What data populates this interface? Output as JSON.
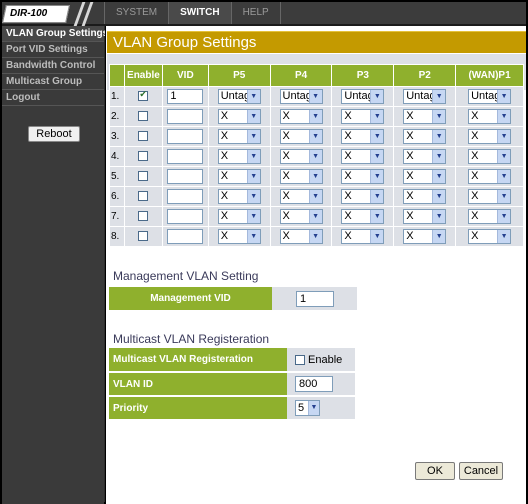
{
  "header": {
    "logo": "DIR-100",
    "tabs": [
      "SYSTEM",
      "SWITCH",
      "HELP"
    ],
    "active_tab": "SWITCH"
  },
  "sidebar": {
    "items": [
      "VLAN Group Settings",
      "Port VID Settings",
      "Bandwidth Control",
      "Multicast Group",
      "Logout"
    ],
    "reboot_label": "Reboot"
  },
  "main": {
    "title": "VLAN Group Settings",
    "columns": [
      "",
      "Enable",
      "VID",
      "P5",
      "P4",
      "P3",
      "P2",
      "(WAN)P1"
    ],
    "rows": [
      {
        "num": "1.",
        "enabled": true,
        "vid": "1",
        "ports": [
          "Untag",
          "Untag",
          "Untag",
          "Untag",
          "Untag"
        ]
      },
      {
        "num": "2.",
        "enabled": false,
        "vid": "",
        "ports": [
          "X",
          "X",
          "X",
          "X",
          "X"
        ]
      },
      {
        "num": "3.",
        "enabled": false,
        "vid": "",
        "ports": [
          "X",
          "X",
          "X",
          "X",
          "X"
        ]
      },
      {
        "num": "4.",
        "enabled": false,
        "vid": "",
        "ports": [
          "X",
          "X",
          "X",
          "X",
          "X"
        ]
      },
      {
        "num": "5.",
        "enabled": false,
        "vid": "",
        "ports": [
          "X",
          "X",
          "X",
          "X",
          "X"
        ]
      },
      {
        "num": "6.",
        "enabled": false,
        "vid": "",
        "ports": [
          "X",
          "X",
          "X",
          "X",
          "X"
        ]
      },
      {
        "num": "7.",
        "enabled": false,
        "vid": "",
        "ports": [
          "X",
          "X",
          "X",
          "X",
          "X"
        ]
      },
      {
        "num": "8.",
        "enabled": false,
        "vid": "",
        "ports": [
          "X",
          "X",
          "X",
          "X",
          "X"
        ]
      }
    ],
    "management": {
      "section_title": "Management VLAN Setting",
      "label": "Management VID",
      "value": "1"
    },
    "multicast": {
      "section_title": "Multicast VLAN Registeration",
      "reg_label": "Multicast VLAN Registeration",
      "enable_label": "Enable",
      "enabled": false,
      "vlan_id_label": "VLAN ID",
      "vlan_id_value": "800",
      "priority_label": "Priority",
      "priority_value": "5"
    },
    "ok_label": "OK",
    "cancel_label": "Cancel"
  },
  "colors": {
    "title_bar": "#c49a00",
    "header_green": "#8fb02d",
    "cell_gray": "#dde0e6",
    "chrome_dark": "#3a3a3a"
  }
}
